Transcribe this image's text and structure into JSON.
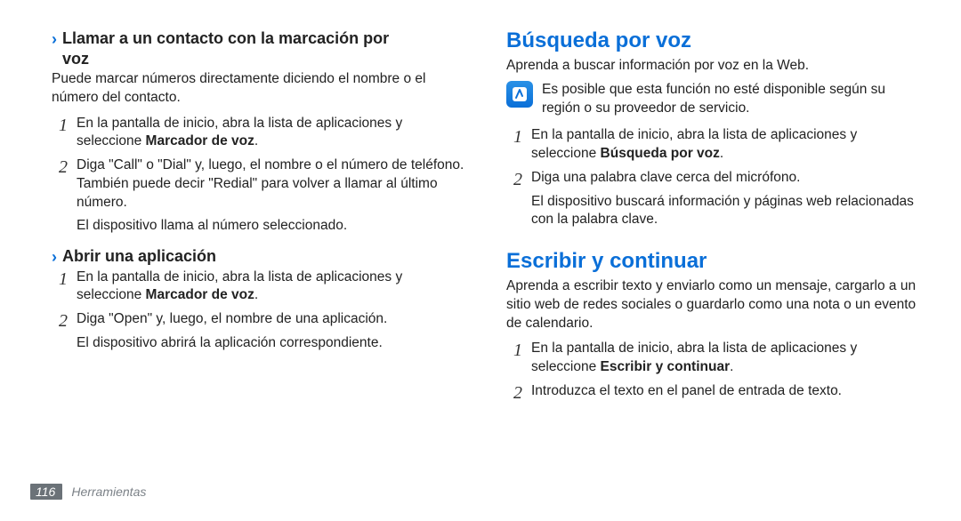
{
  "left": {
    "sub1": {
      "arrow": "›",
      "title_line1": "Llamar a un contacto con la marcación por",
      "title_line2": "voz",
      "intro": "Puede marcar números directamente diciendo el nombre o el número del contacto.",
      "steps": [
        {
          "num": "1",
          "text_before": "En la pantalla de inicio, abra la lista de aplicaciones y seleccione ",
          "bold": "Marcador de voz",
          "text_after": "."
        },
        {
          "num": "2",
          "text": "Diga \"Call\" o \"Dial\" y, luego, el nombre o el número de teléfono. También puede decir \"Redial\" para volver a llamar al último número.",
          "extra": "El dispositivo llama al número seleccionado."
        }
      ]
    },
    "sub2": {
      "arrow": "›",
      "title": "Abrir una aplicación",
      "steps": [
        {
          "num": "1",
          "text_before": "En la pantalla de inicio, abra la lista de aplicaciones y seleccione ",
          "bold": "Marcador de voz",
          "text_after": "."
        },
        {
          "num": "2",
          "text": "Diga \"Open\" y, luego, el nombre de una aplicación.",
          "extra": "El dispositivo abrirá la aplicación correspondiente."
        }
      ]
    }
  },
  "right": {
    "sec1": {
      "title": "Búsqueda por voz",
      "intro": "Aprenda a buscar información por voz en la Web.",
      "note": "Es posible que esta función no esté disponible según su región o su proveedor de servicio.",
      "steps": [
        {
          "num": "1",
          "text_before": "En la pantalla de inicio, abra la lista de aplicaciones y seleccione ",
          "bold": "Búsqueda por voz",
          "text_after": "."
        },
        {
          "num": "2",
          "text": "Diga una palabra clave cerca del micrófono.",
          "extra": "El dispositivo buscará información y páginas web relacionadas con la palabra clave."
        }
      ]
    },
    "sec2": {
      "title": "Escribir y continuar",
      "intro": "Aprenda a escribir texto y enviarlo como un mensaje, cargarlo a un sitio web de redes sociales o guardarlo como una nota o un evento de calendario.",
      "steps": [
        {
          "num": "1",
          "text_before": "En la pantalla de inicio, abra la lista de aplicaciones y seleccione ",
          "bold": "Escribir y continuar",
          "text_after": "."
        },
        {
          "num": "2",
          "text": "Introduzca el texto en el panel de entrada de texto."
        }
      ]
    }
  },
  "footer": {
    "page": "116",
    "section": "Herramientas"
  }
}
